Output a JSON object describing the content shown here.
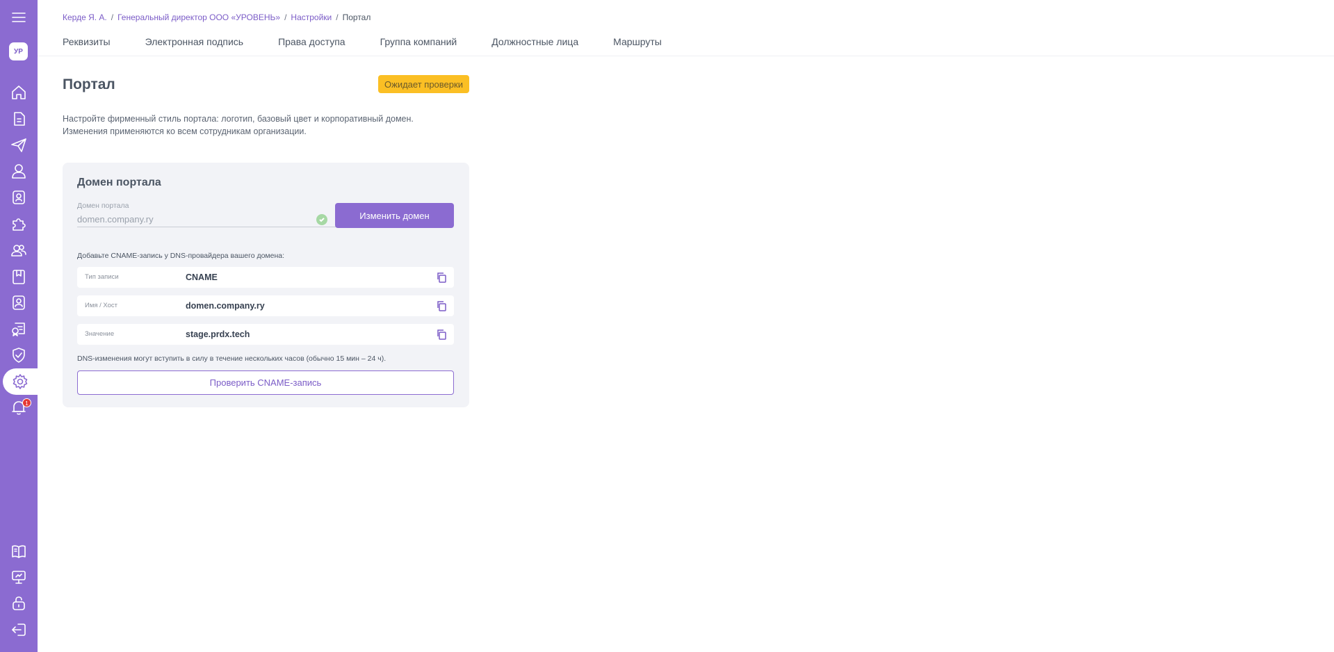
{
  "sidebar": {
    "avatar": "УР",
    "notification_count": "1",
    "icons": [
      "menu-icon",
      "home-icon",
      "document-icon",
      "send-icon",
      "user-icon",
      "badge-icon",
      "puzzle-icon",
      "users-icon",
      "bookmark-book-icon",
      "contact-card-icon",
      "certificate-icon",
      "shield-check-icon",
      "gear-icon",
      "bell-icon",
      "book-icon",
      "presentation-icon",
      "lock-open-icon",
      "logout-icon"
    ]
  },
  "breadcrumb": {
    "items": [
      "Керде Я. А.",
      "Генеральный директор ООО «УРОВЕНЬ»",
      "Настройки"
    ],
    "current": "Портал",
    "separator": "/"
  },
  "tabs": [
    "Реквизиты",
    "Электронная подпись",
    "Права доступа",
    "Группа компаний",
    "Должностные лица",
    "Маршруты"
  ],
  "page": {
    "title": "Портал",
    "status": "Ожидает проверки",
    "description_line1": "Настройте фирменный стиль портала: логотип, базовый цвет и корпоративный домен.",
    "description_line2": "Изменения применяются ко всем сотрудникам организации."
  },
  "domain_card": {
    "title": "Домен портала",
    "field_label": "Домен портала",
    "field_value": "domen.company.ry",
    "change_button": "Изменить домен",
    "dns_hint": "Добавьте CNAME-запись у DNS-провайдера вашего домена:",
    "records": [
      {
        "key": "Тип записи",
        "value": "CNAME"
      },
      {
        "key": "Имя / Хост",
        "value": "domen.company.ry"
      },
      {
        "key": "Значение",
        "value": "stage.prdx.tech"
      }
    ],
    "dns_note": "DNS-изменения могут вступить в силу в течение нескольких часов (обычно 15 мин – 24 ч).",
    "check_button": "Проверить CNAME-запись"
  },
  "colors": {
    "accent": "#8b6bd1",
    "status_badge": "#fbbf24",
    "notification": "#e53935"
  }
}
